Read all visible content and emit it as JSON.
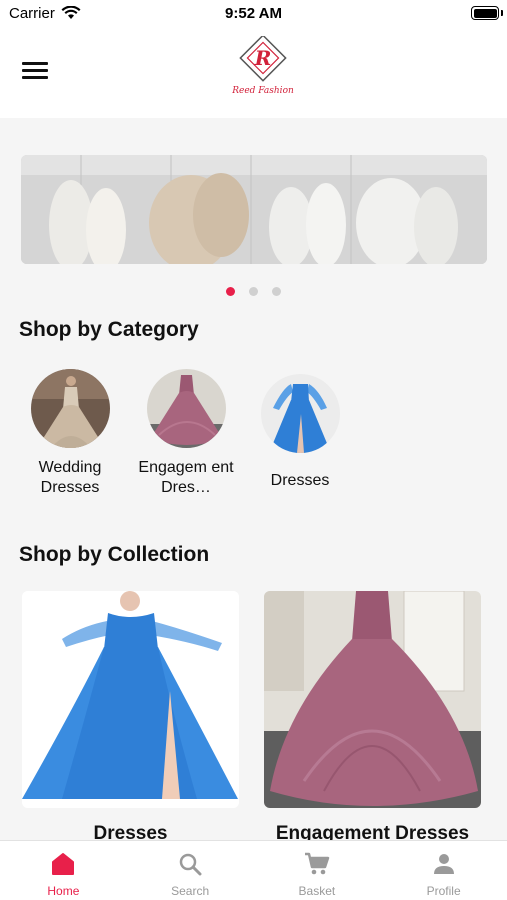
{
  "status_bar": {
    "carrier": "Carrier",
    "time": "9:52 AM"
  },
  "header": {
    "logo_text": "Reed Fashion"
  },
  "carousel": {
    "page_count": 3,
    "active_index": 0
  },
  "categories": {
    "title": "Shop by Category",
    "items": [
      {
        "label": "Wedding Dresses",
        "color": "#cbb9a3"
      },
      {
        "label": "Engagem ent Dres…",
        "color": "#a8657e"
      },
      {
        "label": "Dresses",
        "color": "#2f7fd6"
      }
    ]
  },
  "collections": {
    "title": "Shop by Collection",
    "items": [
      {
        "label": "Dresses",
        "color": "#2f7fd6"
      },
      {
        "label": "Engagement Dresses",
        "color": "#a8657e"
      }
    ]
  },
  "tabbar": {
    "accent_color": "#e8204a",
    "items": [
      {
        "label": "Home",
        "icon": "home-icon",
        "active": true
      },
      {
        "label": "Search",
        "icon": "search-icon",
        "active": false
      },
      {
        "label": "Basket",
        "icon": "cart-icon",
        "active": false
      },
      {
        "label": "Profile",
        "icon": "person-icon",
        "active": false
      }
    ]
  }
}
